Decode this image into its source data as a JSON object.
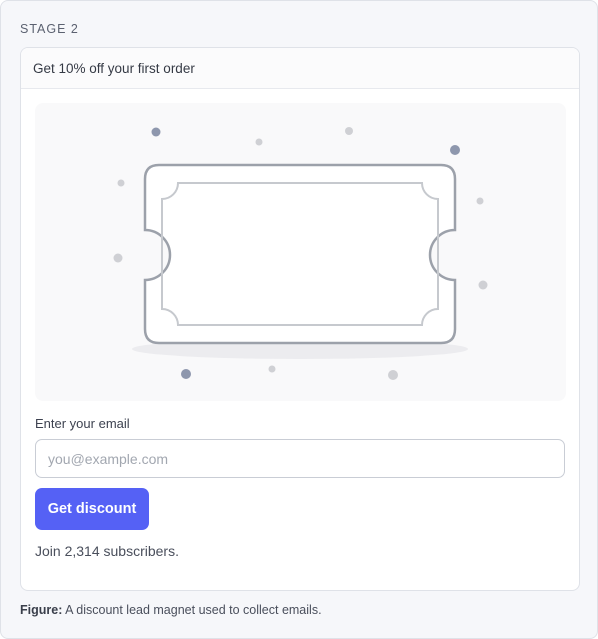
{
  "stage": {
    "label": "STAGE 2"
  },
  "card": {
    "header": "Get 10% off your first order",
    "illustration": {
      "icon": "ticket-coupon-icon",
      "colors": {
        "outline": "#9ca1aa",
        "inner": "#c6c9ce",
        "dot_dark": "#8e97ad",
        "dot_light": "#cfd0d4",
        "shadow": "#ececef"
      }
    },
    "form": {
      "email_label": "Enter your email",
      "email_placeholder": "you@example.com",
      "email_value": "",
      "button_label": "Get discount",
      "accent": "#5561f5"
    },
    "subscribers": "Join 2,314 subscribers."
  },
  "caption": {
    "prefix": "Figure:",
    "text": " A discount lead magnet used to collect emails."
  }
}
